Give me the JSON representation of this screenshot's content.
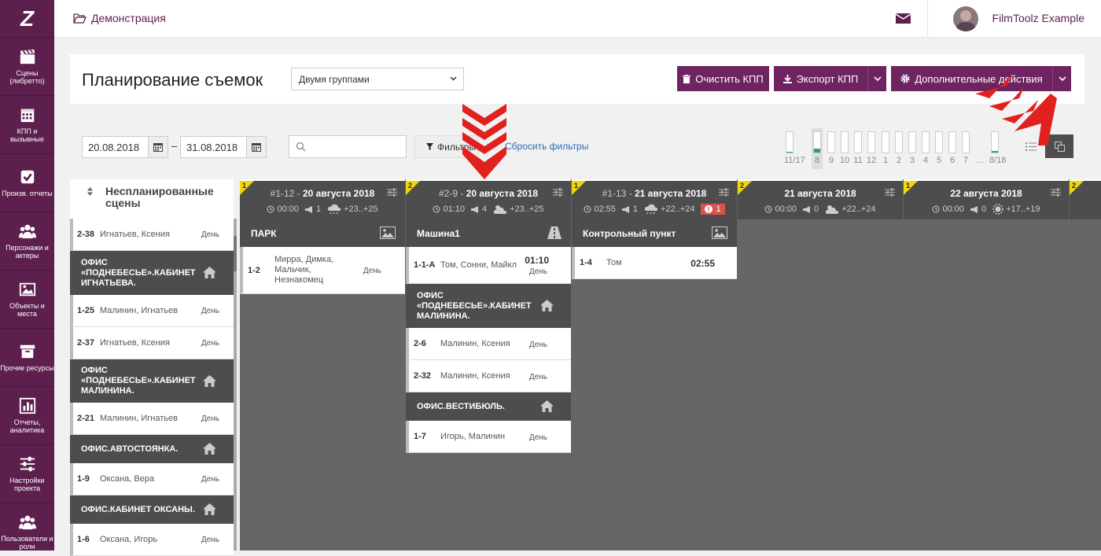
{
  "sidebar": {
    "logo": "Z",
    "items": [
      {
        "label": "Сцены (либретто)",
        "icon": "clapperboard-icon"
      },
      {
        "label": "КПП и вызывные",
        "icon": "calendar-icon"
      },
      {
        "label": "Произв. отчеты",
        "icon": "checkbox-icon"
      },
      {
        "label": "Персонажи и актеры",
        "icon": "users-icon"
      },
      {
        "label": "Объекты и места",
        "icon": "image-icon"
      },
      {
        "label": "Прочие ресурсы",
        "icon": "archive-icon"
      },
      {
        "label": "Отчеты, аналитика",
        "icon": "bar-chart-icon"
      },
      {
        "label": "Настройки проекта",
        "icon": "sliders-icon"
      },
      {
        "label": "Пользователи и роли",
        "icon": "users-icon"
      }
    ]
  },
  "topbar": {
    "breadcrumb": "Демонстрация",
    "username": "FilmToolz Example"
  },
  "header": {
    "title": "Планирование съемок",
    "grouping": "Двумя группами",
    "clear_label": "Очистить КПП",
    "export_label": "Экспорт КПП",
    "more_label": "Дополнительные действия"
  },
  "filters": {
    "date_from": "20.08.2018",
    "date_sep": "–",
    "date_to": "31.08.2018",
    "search_placeholder": "",
    "filters_label": "Фильтры",
    "reset_label": "Сбросить фильтры",
    "mini_days": [
      {
        "label": "11/17",
        "fill": 0.05
      },
      {
        "label": "8",
        "fill": 0.2
      },
      {
        "label": "9",
        "fill": 0
      },
      {
        "label": "10",
        "fill": 0
      },
      {
        "label": "11",
        "fill": 0
      },
      {
        "label": "12",
        "fill": 0
      },
      {
        "label": "1",
        "fill": 0
      },
      {
        "label": "2",
        "fill": 0
      },
      {
        "label": "3",
        "fill": 0
      },
      {
        "label": "4",
        "fill": 0
      },
      {
        "label": "5",
        "fill": 0
      },
      {
        "label": "6",
        "fill": 0
      },
      {
        "label": "7",
        "fill": 0
      },
      {
        "label": "...",
        "fill": 0
      },
      {
        "label": "8/18",
        "fill": 0.08
      }
    ]
  },
  "unplanned": {
    "title_line1": "Неспланированные",
    "title_line2": "сцены",
    "scene_2_38": {
      "num": "2-38",
      "names": "Игнатьев, Ксения",
      "tod": "День"
    },
    "loc_ignatiev": "ОФИС «ПОДНЕБЕСЬЕ».КАБИНЕТ ИГНАТЬЕВА.",
    "scene_1_25": {
      "num": "1-25",
      "names": "Малинин, Игнатьев",
      "tod": "День"
    },
    "scene_2_37": {
      "num": "2-37",
      "names": "Игнатьев, Ксения",
      "tod": "День"
    },
    "loc_malinin": "ОФИС «ПОДНЕБЕСЬЕ».КАБИНЕТ МАЛИНИНА.",
    "scene_2_21": {
      "num": "2-21",
      "names": "Малинин, Игнатьев",
      "tod": "День"
    },
    "loc_parking": "ОФИС.АВТОСТОЯНКА.",
    "scene_1_9": {
      "num": "1-9",
      "names": "Оксана, Вера",
      "tod": "День"
    },
    "loc_oksana": "ОФИС.КАБИНЕТ ОКСАНЫ.",
    "scene_1_6": {
      "num": "1-6",
      "names": "Оксана, Игорь",
      "tod": "День"
    }
  },
  "days": [
    {
      "corner": "1",
      "code": "#1-12 - ",
      "date": "20 августа 2018",
      "time": "00:00",
      "flags": "1",
      "temp": "+23..+25",
      "location": "ПАРК",
      "scene": {
        "num": "1-2",
        "names": "Мирра, Димка, Мальчик, Незнакомец",
        "tod": "День"
      }
    },
    {
      "corner": "2",
      "code": "#2-9 - ",
      "date": "20 августа 2018",
      "time": "01:10",
      "flags": "4",
      "temp": "+23..+25",
      "location": "Машина1",
      "scene_a": {
        "num": "1-1-А",
        "names": "Том, Сонни, Майкл",
        "tm": "01:10",
        "tod": "День"
      },
      "loc_malinin": "ОФИС «ПОДНЕБЕСЬЕ».КАБИНЕТ МАЛИНИНА.",
      "scene_b": {
        "num": "2-6",
        "names": "Малинин, Ксения",
        "tod": "День"
      },
      "scene_c": {
        "num": "2-32",
        "names": "Малинин, Ксения",
        "tod": "День"
      },
      "loc_lobby": "ОФИС.ВЕСТИБЮЛЬ.",
      "scene_d": {
        "num": "1-7",
        "names": "Игорь, Малинин",
        "tod": "День"
      }
    },
    {
      "corner": "1",
      "code": "#1-13 - ",
      "date": "21 августа 2018",
      "time": "02:55",
      "flags": "1",
      "temp": "+22..+24",
      "warn": "1",
      "location": "Контрольный пункт",
      "scene": {
        "num": "1-4",
        "names": "Том",
        "tm": "02:55"
      }
    },
    {
      "corner": "2",
      "code": "",
      "date": "21 августа 2018",
      "time": "00:00",
      "flags": "0",
      "temp": "+22..+24"
    },
    {
      "corner": "1",
      "code": "",
      "date": "22 августа 2018",
      "time": "00:00",
      "flags": "0",
      "temp": "+17..+19"
    },
    {
      "corner": "2"
    }
  ],
  "colors": {
    "brand": "#5d1f4d",
    "button": "#6d2460",
    "dark": "#4d4d4d",
    "board": "#666666",
    "corner": "#f2d60b",
    "warn": "#d9534f",
    "arrow": "#e0211d"
  }
}
